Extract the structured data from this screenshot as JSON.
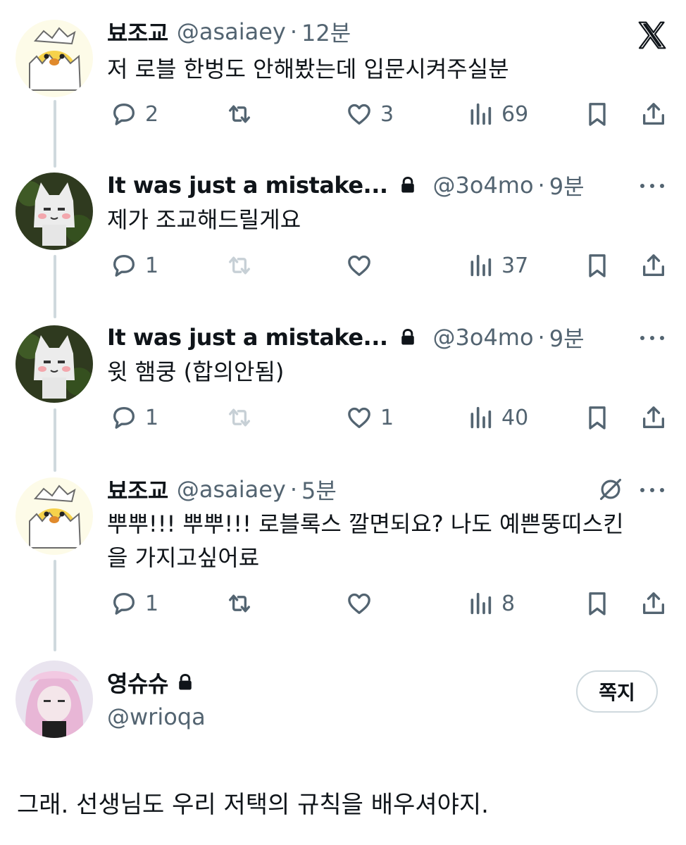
{
  "tweets": [
    {
      "name": "뵤조교",
      "handle": "@asaiaey",
      "time": "12분",
      "text": "저 로블 한벙도 안해봤는데 입문시켜주실분",
      "replies": "2",
      "likes": "3",
      "views": "69"
    },
    {
      "name": "It was just a mistake...",
      "handle": "@3o4mo",
      "time": "9분",
      "text": "제가 조교해드릴게요",
      "replies": "1",
      "views": "37"
    },
    {
      "name": "It was just a mistake...",
      "handle": "@3o4mo",
      "time": "9분",
      "text": "윗 햄쿵 (합의안됨)",
      "replies": "1",
      "likes": "1",
      "views": "40"
    },
    {
      "name": "뵤조교",
      "handle": "@asaiaey",
      "time": "5분",
      "text_line1": "뿌뿌!!! 뿌뿌!!! 로블록스 깔면되요? 나도 예쁜뚱띠스킨",
      "text_line2": "을 가지고싶어료",
      "replies": "1",
      "views": "8"
    }
  ],
  "profile": {
    "name": "영슈슈",
    "handle": "@wrioqa",
    "dm_label": "쪽지"
  },
  "final_text": "그래. 선생님도 우리 저택의 규칙을 배우셔야지.",
  "dot": "·",
  "colors": {
    "text": "#0f1419",
    "muted": "#536471",
    "line": "#cfd9de"
  }
}
